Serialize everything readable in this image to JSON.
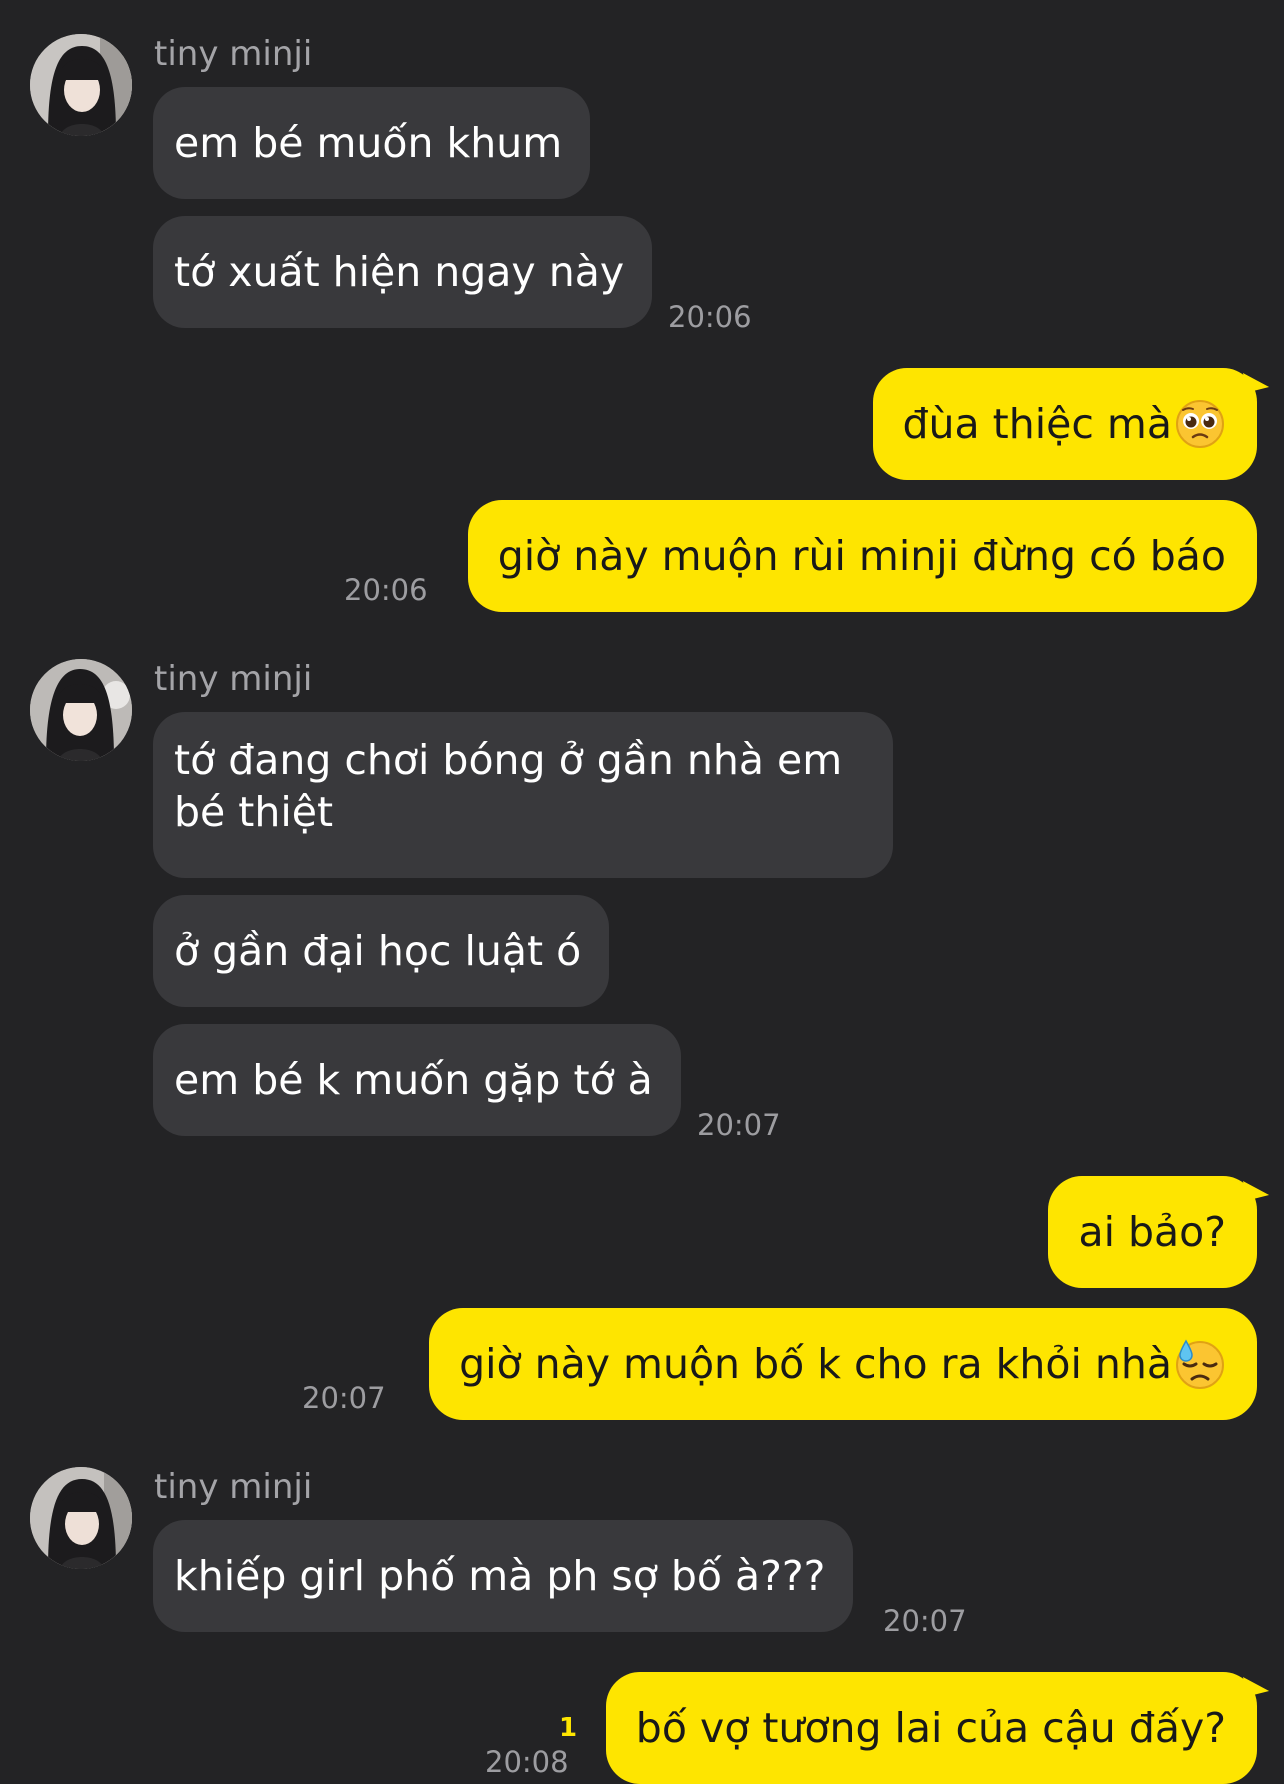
{
  "chat": {
    "sender_name": "tiny minji",
    "blocks": [
      {
        "messages": [
          {
            "text": "em bé muốn khum"
          },
          {
            "text": "tớ xuất hiện ngay này"
          }
        ],
        "time": "20:06"
      },
      {
        "messages": [
          {
            "text": "đùa thiệc mà",
            "emoji": "pleading-face-icon"
          },
          {
            "text": "giờ này muộn rùi minji đừng có báo"
          }
        ],
        "time": "20:06"
      },
      {
        "messages": [
          {
            "text": "tớ đang chơi bóng ở gần nhà em bé thiệt"
          },
          {
            "text": "ở gần đại học luật ó"
          },
          {
            "text": "em bé k muốn gặp tớ à"
          }
        ],
        "time": "20:07"
      },
      {
        "messages": [
          {
            "text": "ai bảo?"
          },
          {
            "text": "giờ này muộn bố k cho ra khỏi nhà",
            "emoji": "downcast-sweat-face-icon"
          }
        ],
        "time": "20:07"
      },
      {
        "messages": [
          {
            "text": "khiếp girl phố mà ph sợ bố à???"
          }
        ],
        "time": "20:07"
      },
      {
        "messages": [
          {
            "text": "bố vợ tương lai của cậu đấy?"
          }
        ],
        "time": "20:08",
        "unread_count": "1"
      }
    ]
  },
  "colors": {
    "background": "#232325",
    "incoming_bubble": "#39393c",
    "outgoing_bubble": "#fee500",
    "unread": "#fee500"
  }
}
